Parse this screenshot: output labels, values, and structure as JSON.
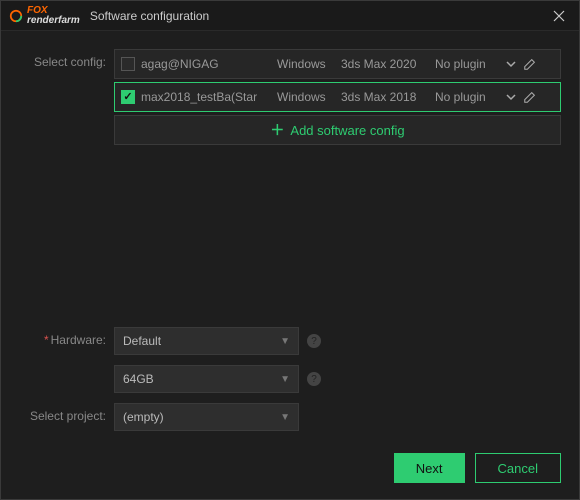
{
  "window": {
    "brand_prefix": "FOX",
    "brand_suffix": "renderfarm",
    "title": "Software configuration"
  },
  "labels": {
    "select_config": "Select config:",
    "hardware": "Hardware:",
    "select_project": "Select project:"
  },
  "configs": [
    {
      "checked": false,
      "name": "agag@NIGAG",
      "os": "Windows",
      "software": "3ds Max 2020",
      "plugin": "No plugin"
    },
    {
      "checked": true,
      "name": "max2018_testBa(Star",
      "os": "Windows",
      "software": "3ds Max 2018",
      "plugin": "No plugin"
    }
  ],
  "add_config_label": "Add software config",
  "hardware": {
    "type": "Default",
    "memory": "64GB"
  },
  "project": {
    "value": "(empty)"
  },
  "buttons": {
    "next": "Next",
    "cancel": "Cancel"
  },
  "colors": {
    "accent": "#2ecc71",
    "brand": "#ff6600",
    "bg": "#1e1e1e"
  }
}
